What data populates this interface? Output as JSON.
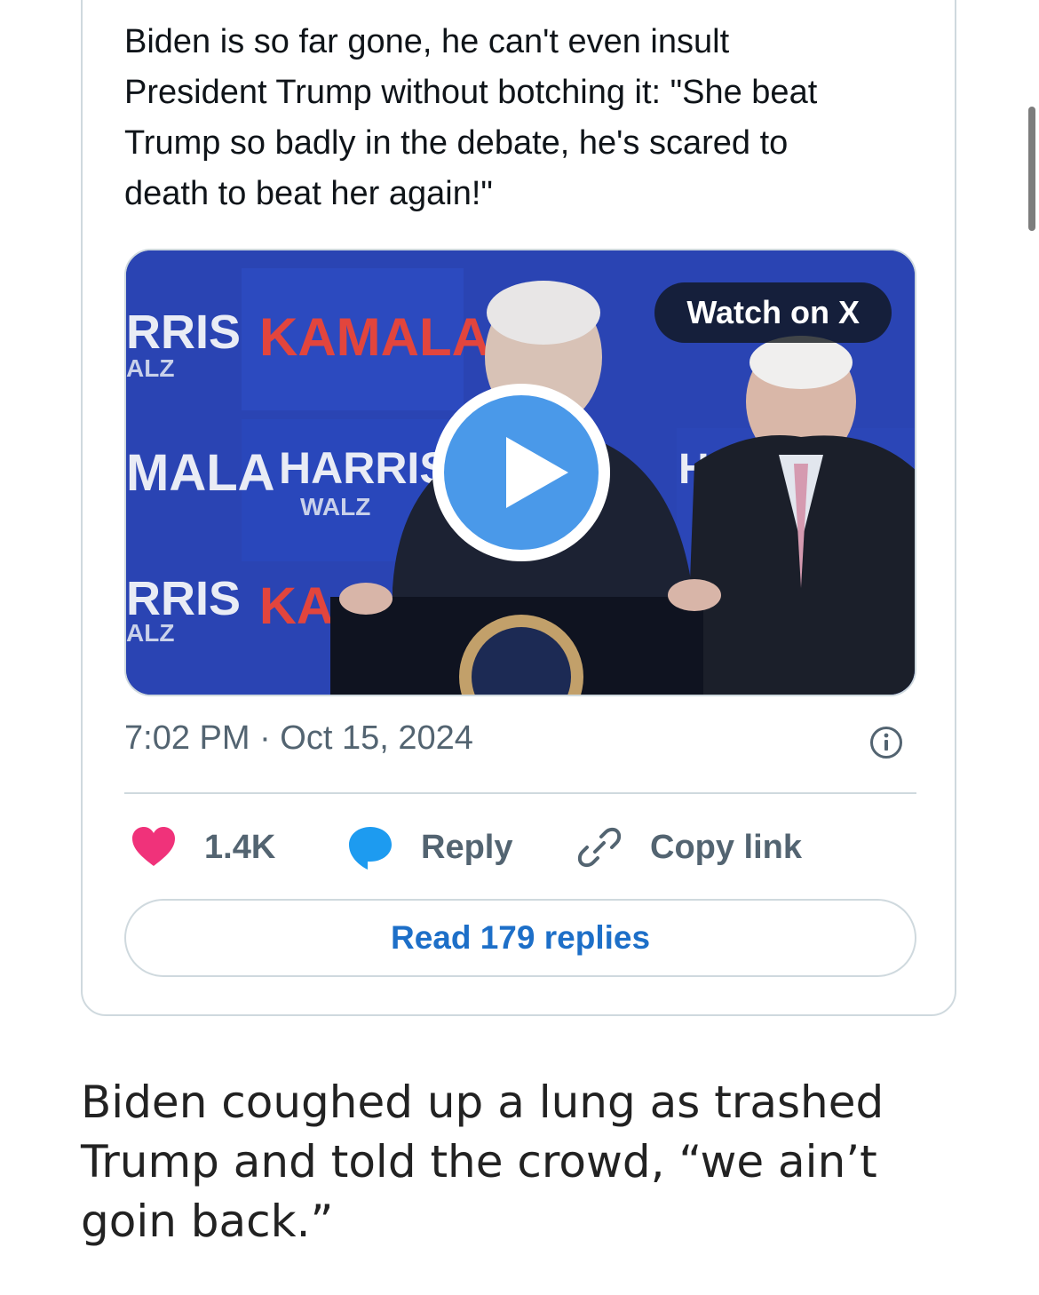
{
  "tweet": {
    "text": "Biden is so far gone, he can't even insult President Trump without botching it: \"She beat Trump so badly in the debate, he's scared to death to beat her again!\"",
    "video": {
      "watch_label": "Watch on X",
      "backdrop_signs": [
        "RRIS",
        "KAMALA",
        "HARRIS",
        "WALZ",
        "MALA",
        "KA",
        "HAR",
        "ALZ"
      ]
    },
    "timestamp": "7:02 PM · Oct 15, 2024",
    "actions": {
      "likes": "1.4K",
      "reply_label": "Reply",
      "copy_label": "Copy link"
    },
    "read_replies_label": "Read 179 replies"
  },
  "article": {
    "paragraph": "Biden coughed up a lung as trashed Trump and told the crowd, “we ain’t goin back.”"
  },
  "colors": {
    "like": "#f0327a",
    "reply_icon": "#1d9bf0",
    "link_blue": "#1d6fc8",
    "play": "#4a99e9",
    "border": "#cfd9de",
    "muted": "#536471"
  },
  "icons": [
    "heart-icon",
    "comment-bubble-icon",
    "link-icon",
    "info-icon",
    "play-icon"
  ]
}
